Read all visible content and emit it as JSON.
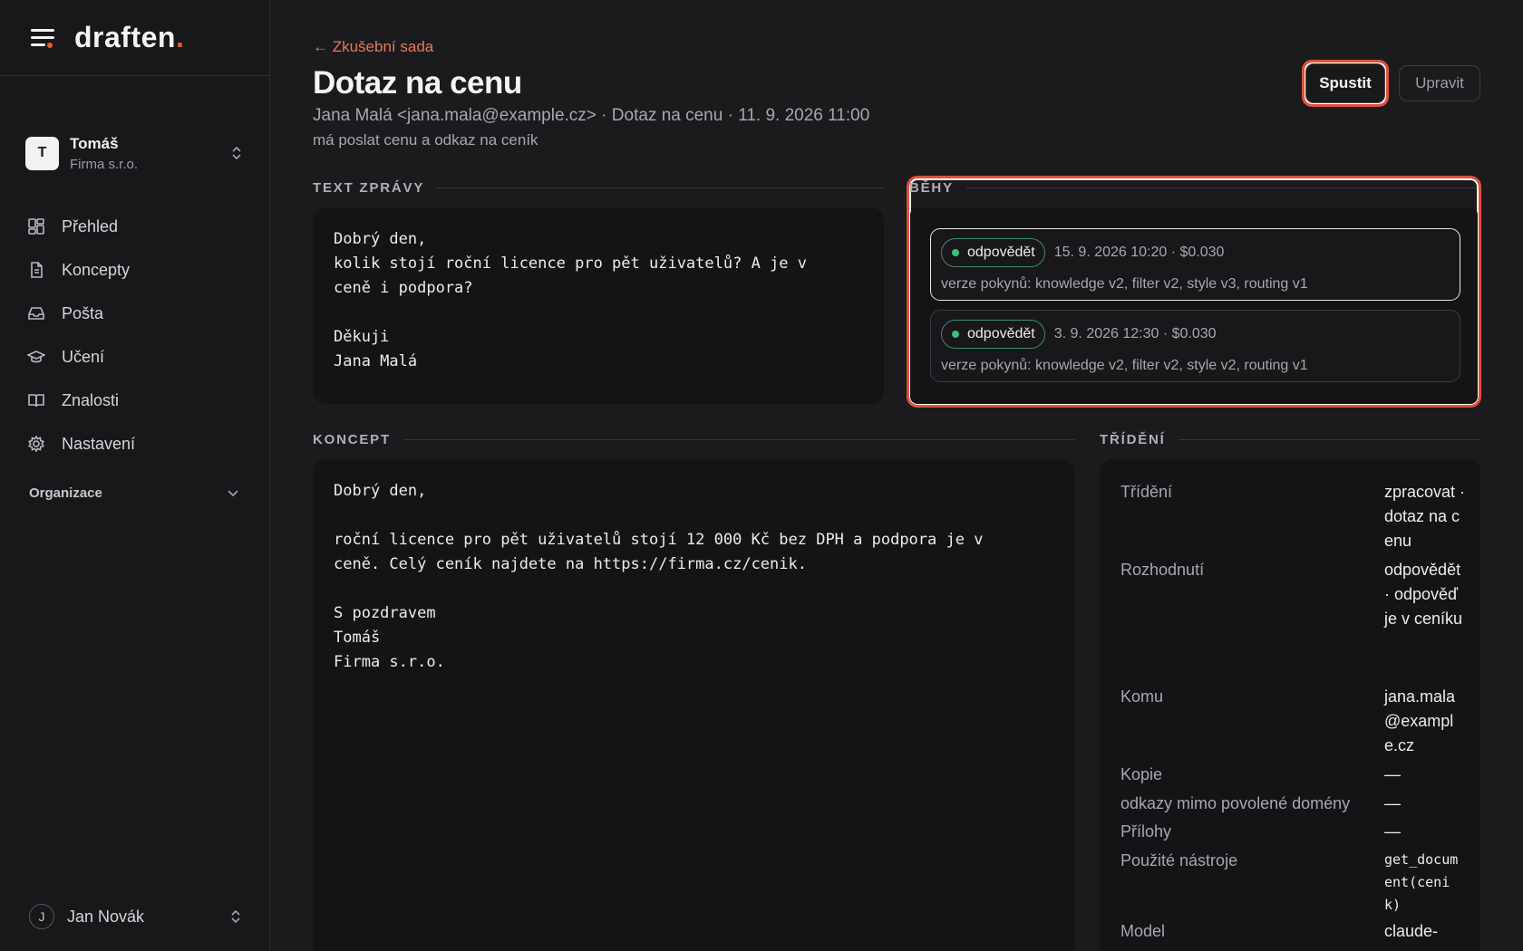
{
  "brand": {
    "name": "draften",
    "accent": "."
  },
  "workspace": {
    "initial": "T",
    "name": "Tomáš",
    "company": "Firma s.r.o."
  },
  "nav": [
    {
      "label": "Přehled",
      "icon": "dashboard-icon"
    },
    {
      "label": "Koncepty",
      "icon": "document-icon"
    },
    {
      "label": "Pošta",
      "icon": "inbox-icon"
    },
    {
      "label": "Učení",
      "icon": "graduation-cap-icon"
    },
    {
      "label": "Znalosti",
      "icon": "book-icon"
    },
    {
      "label": "Nastavení",
      "icon": "gear-icon"
    }
  ],
  "org_label": "Organizace",
  "user": {
    "initial": "J",
    "name": "Jan Novák"
  },
  "header": {
    "back": "← Zkušební sada",
    "title": "Dotaz na cenu",
    "meta": "Jana Malá <jana.mala@example.cz> · Dotaz na cenu · 11. 9. 2026 11:00",
    "summary": "má poslat cenu a odkaz na ceník",
    "run_button": "Spustit",
    "edit_button": "Upravit"
  },
  "message": {
    "label": "TEXT ZPRÁVY",
    "body": "Dobrý den,\nkolik stojí roční licence pro pět uživatelů? A je v\nceně i podpora?\n\nDěkuji\nJana Malá"
  },
  "runs": {
    "label": "BĚHY",
    "items": [
      {
        "status": "odpovědět",
        "meta": "15. 9. 2026 10:20 · $0.030",
        "desc": "verze pokynů: knowledge v2, filter v2, style v3, routing v1"
      },
      {
        "status": "odpovědět",
        "meta": "3. 9. 2026 12:30 · $0.030",
        "desc": "verze pokynů: knowledge v2, filter v2, style v2, routing v1"
      }
    ]
  },
  "draft": {
    "label": "KONCEPT",
    "body": "Dobrý den,\n\nroční licence pro pět uživatelů stojí 12 000 Kč bez DPH a podpora je v\nceně. Celý ceník najdete na https://firma.cz/cenik.\n\nS pozdravem\nTomáš\nFirma s.r.o."
  },
  "triage": {
    "label": "TŘÍDĚNÍ",
    "rows": [
      {
        "key": "Třídění",
        "value": "zpracovat · dotaz na cenu"
      },
      {
        "key": "Rozhodnutí",
        "value": "odpovědět · odpověď je v ceníku"
      },
      {
        "key": "Komu",
        "value": "jana.mala@example.cz"
      },
      {
        "key": "Kopie",
        "value": "—"
      },
      {
        "key": "odkazy mimo povolené domény",
        "value": "—"
      },
      {
        "key": "Přílohy",
        "value": "—"
      },
      {
        "key": "Použité nástroje",
        "value": "get_document(cenik)"
      },
      {
        "key": "Model",
        "value": "claude-"
      }
    ]
  },
  "colors": {
    "accent": "#e85a3a",
    "status_green": "#39c07f",
    "background": "#1b1b1e"
  }
}
